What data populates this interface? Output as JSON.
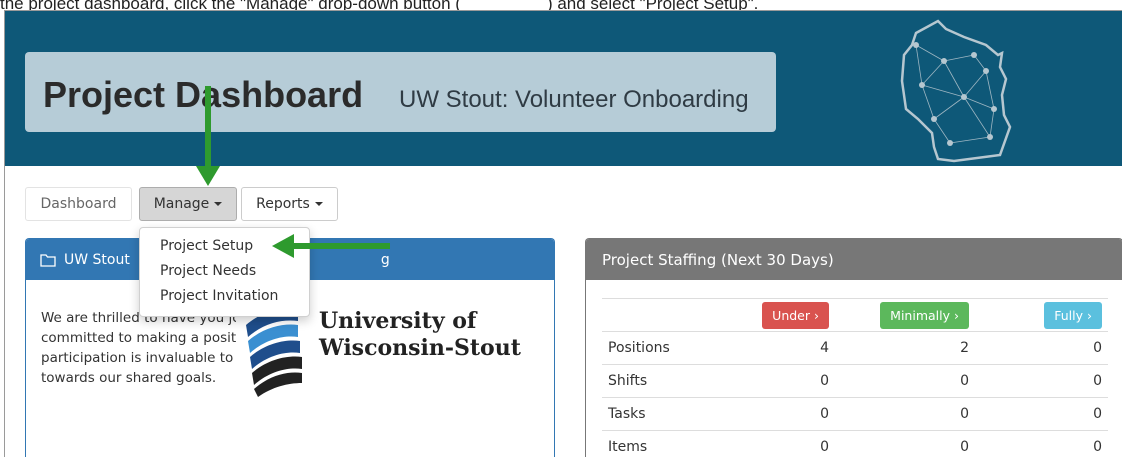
{
  "instruction": {
    "before": "the project dashboard, click the \"Manage\" drop-down button (",
    "after": ") and select \"Project Setup\"."
  },
  "header": {
    "title": "Project Dashboard",
    "subtitle": "UW Stout: Volunteer Onboarding",
    "map_icon": "wisconsin-network-map-icon",
    "colors": {
      "banner": "#0e5878",
      "title_box": "#b6ccd7"
    }
  },
  "nav": {
    "dashboard": "Dashboard",
    "manage": "Manage",
    "reports": "Reports"
  },
  "manage_menu": {
    "items": [
      "Project Setup",
      "Project Needs",
      "Project Invitation"
    ]
  },
  "welcome_panel": {
    "title_start": "UW Stout",
    "title_end": "g",
    "icon": "folder-icon",
    "text": "We are thrilled to have you join our team of dedicated volunteers, committed to making a positive impact on our community. Your participation is invaluable to us, and we are excited to work together towards our shared goals.",
    "logo_line1": "University of",
    "logo_line2": "Wisconsin-Stout"
  },
  "staffing": {
    "title": "Project Staffing (Next 30 Days)",
    "buttons": {
      "under": "Under",
      "minimally": "Minimally",
      "fully": "Fully"
    },
    "colors": {
      "under": "#d9534f",
      "minimally": "#5cb85c",
      "fully": "#5bc0de",
      "header": "#777777"
    },
    "rows": [
      {
        "label": "Positions",
        "under": "4",
        "minimally": "2",
        "fully": "0"
      },
      {
        "label": "Shifts",
        "under": "0",
        "minimally": "0",
        "fully": "0"
      },
      {
        "label": "Tasks",
        "under": "0",
        "minimally": "0",
        "fully": "0"
      },
      {
        "label": "Items",
        "under": "0",
        "minimally": "0",
        "fully": "0"
      }
    ]
  },
  "annotations": {
    "arrow_color": "#2e9a2e"
  }
}
